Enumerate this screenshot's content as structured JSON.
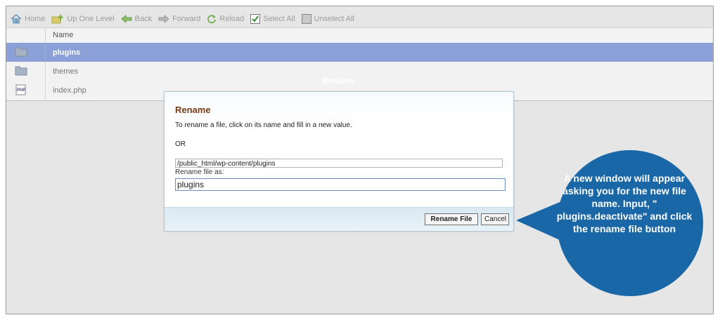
{
  "toolbar": {
    "home": "Home",
    "up_one_level": "Up One Level",
    "back": "Back",
    "forward": "Forward",
    "reload": "Reload",
    "select_all": "Select All",
    "unselect_all": "Unselect All"
  },
  "file_table": {
    "column_name": "Name",
    "rows": [
      {
        "name": "plugins",
        "icon": "folder-icon",
        "selected": true
      },
      {
        "name": "themes",
        "icon": "folder-icon",
        "selected": false
      },
      {
        "name": "index.php",
        "icon": "php-file-icon",
        "selected": false
      }
    ]
  },
  "dialog": {
    "window_title": "Rename",
    "heading": "Rename",
    "instructions": "To rename a file, click on its name and fill in a new value.",
    "or_text": "OR",
    "path": "/public_html/wp-content/plugins",
    "rename_label": "Rename file as:",
    "rename_value": "plugins",
    "rename_button": "Rename File",
    "cancel_button": "Cancel"
  },
  "callout": {
    "text": "A new window will appear asking you for the new file name. Input, \" plugins.deactivate\" and click the rename file button",
    "color": "#1967a7"
  },
  "colors": {
    "selected_row": "#8aa0d6",
    "dialog_heading": "#7a3a16"
  }
}
